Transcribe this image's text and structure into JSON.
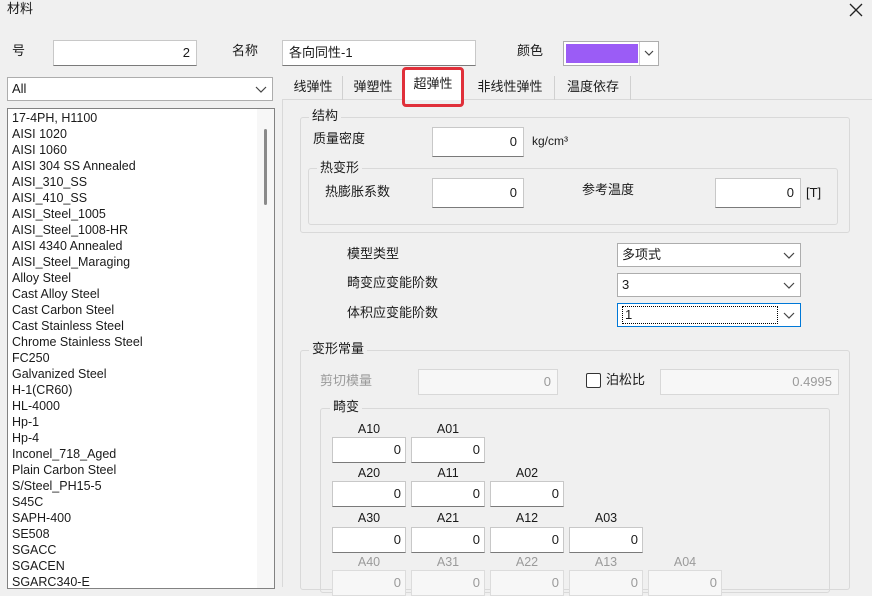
{
  "window": {
    "title": "材料"
  },
  "form": {
    "number_label": "号",
    "number_value": "2",
    "name_label": "名称",
    "name_value": "各向同性-1",
    "color_label": "颜色",
    "color_value": "#9b5cf6"
  },
  "filter": {
    "value": "All"
  },
  "materials": [
    "17-4PH, H1100",
    "AISI 1020",
    "AISI 1060",
    "AISI 304 SS Annealed",
    "AISI_310_SS",
    "AISI_410_SS",
    "AISI_Steel_1005",
    "AISI_Steel_1008-HR",
    "AISI 4340 Annealed",
    "AISI_Steel_Maraging",
    "Alloy Steel",
    "Cast Alloy Steel",
    "Cast Carbon Steel",
    "Cast Stainless Steel",
    "Chrome Stainless Steel",
    "FC250",
    "Galvanized Steel",
    "H-1(CR60)",
    "HL-4000",
    "Hp-1",
    "Hp-4",
    "Inconel_718_Aged",
    "Plain Carbon Steel",
    "S/Steel_PH15-5",
    "S45C",
    "SAPH-400",
    "SE508",
    "SGACC",
    "SGACEN",
    "SGARC340-E"
  ],
  "tabs": [
    "线弹性",
    "弹塑性",
    "超弹性",
    "非线性弹性",
    "温度依存"
  ],
  "structure": {
    "title": "结构",
    "density_label": "质量密度",
    "density_value": "0",
    "density_unit": "kg/cm³",
    "thermal": {
      "title": "热变形",
      "expansion_label": "热膨胀系数",
      "expansion_value": "0",
      "ref_temp_label": "参考温度",
      "ref_temp_value": "0",
      "ref_temp_unit": "[T]"
    }
  },
  "model": {
    "type_label": "模型类型",
    "type_value": "多项式",
    "deviatoric_label": "畸变应变能阶数",
    "deviatoric_value": "3",
    "volumetric_label": "体积应变能阶数",
    "volumetric_value": "1"
  },
  "constants": {
    "title": "变形常量",
    "shear_label": "剪切模量",
    "shear_value": "0",
    "poisson_label": "泊松比",
    "poisson_value": "0.4995",
    "distortion": {
      "title": "畸变",
      "labels": [
        "A10",
        "A01",
        "A20",
        "A11",
        "A02",
        "A30",
        "A21",
        "A12",
        "A03",
        "A40",
        "A31",
        "A22",
        "A13",
        "A04"
      ],
      "values": [
        "0",
        "0",
        "0",
        "0",
        "0",
        "0",
        "0",
        "0",
        "0",
        "0",
        "0",
        "0",
        "0",
        "0"
      ]
    }
  }
}
